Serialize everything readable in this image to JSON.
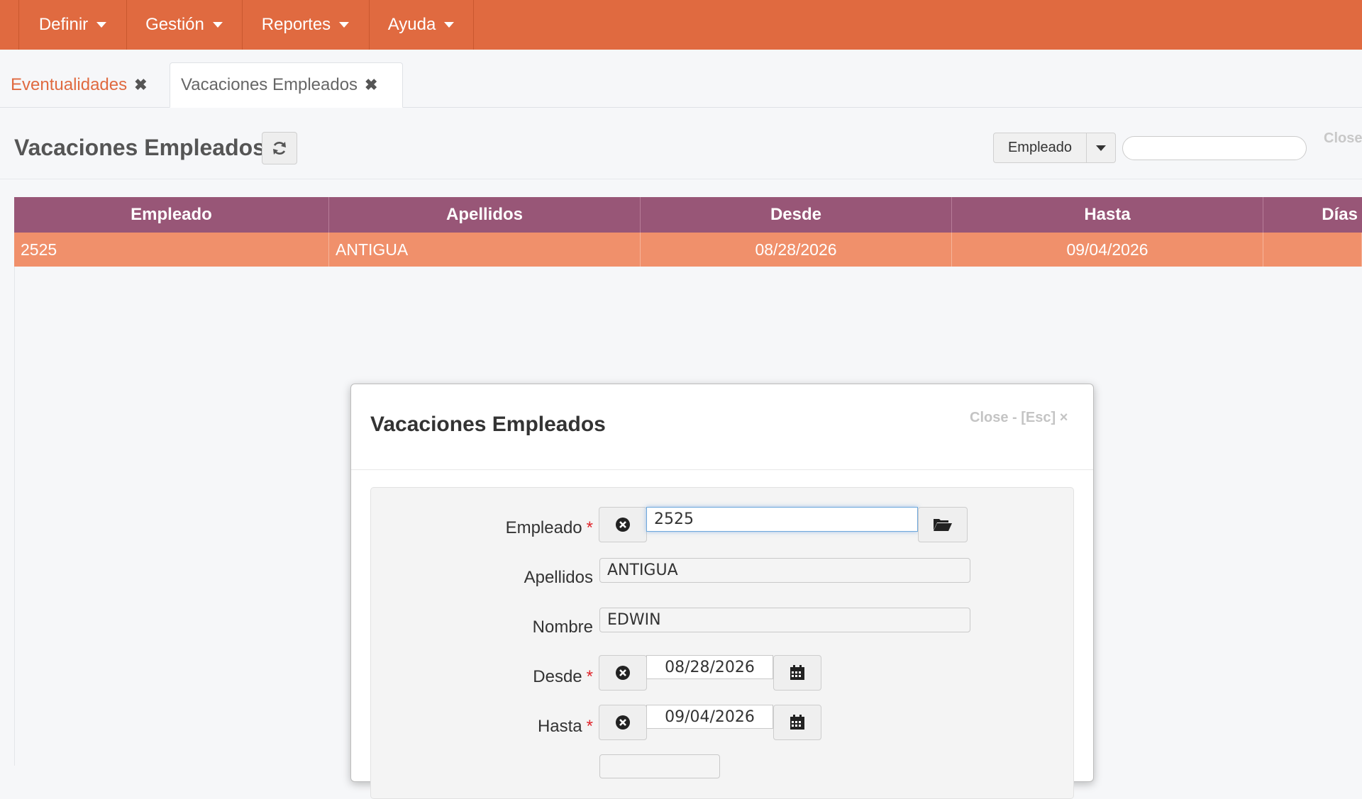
{
  "nav": {
    "menus": [
      {
        "label": "Definir"
      },
      {
        "label": "Gestión"
      },
      {
        "label": "Reportes"
      },
      {
        "label": "Ayuda"
      }
    ]
  },
  "tabs": [
    {
      "label": "Eventualidades",
      "active": false
    },
    {
      "label": "Vacaciones Empleados",
      "active": true
    }
  ],
  "page": {
    "title": "Vacaciones Empleados",
    "filter_label": "Empleado",
    "search_placeholder": "",
    "close_label": "Close"
  },
  "grid": {
    "columns": [
      "Empleado",
      "Apellidos",
      "Desde",
      "Hasta",
      "Días"
    ],
    "rows": [
      [
        "2525",
        "ANTIGUA",
        "08/28/2026",
        "09/04/2026",
        ""
      ]
    ]
  },
  "modal": {
    "title": "Vacaciones Empleados",
    "close_label": "Close - [Esc] ×",
    "fields": {
      "empleado": {
        "label": "Empleado",
        "value": "2525"
      },
      "apellidos": {
        "label": "Apellidos",
        "value": "ANTIGUA"
      },
      "nombre": {
        "label": "Nombre",
        "value": "EDWIN"
      },
      "desde": {
        "label": "Desde",
        "value": "08/28/2026"
      },
      "hasta": {
        "label": "Hasta",
        "value": "09/04/2026"
      }
    },
    "required_mark": "*"
  },
  "colors": {
    "brand": "#e06a40",
    "grid_header": "#985677",
    "selected_row": "#f0906b"
  }
}
